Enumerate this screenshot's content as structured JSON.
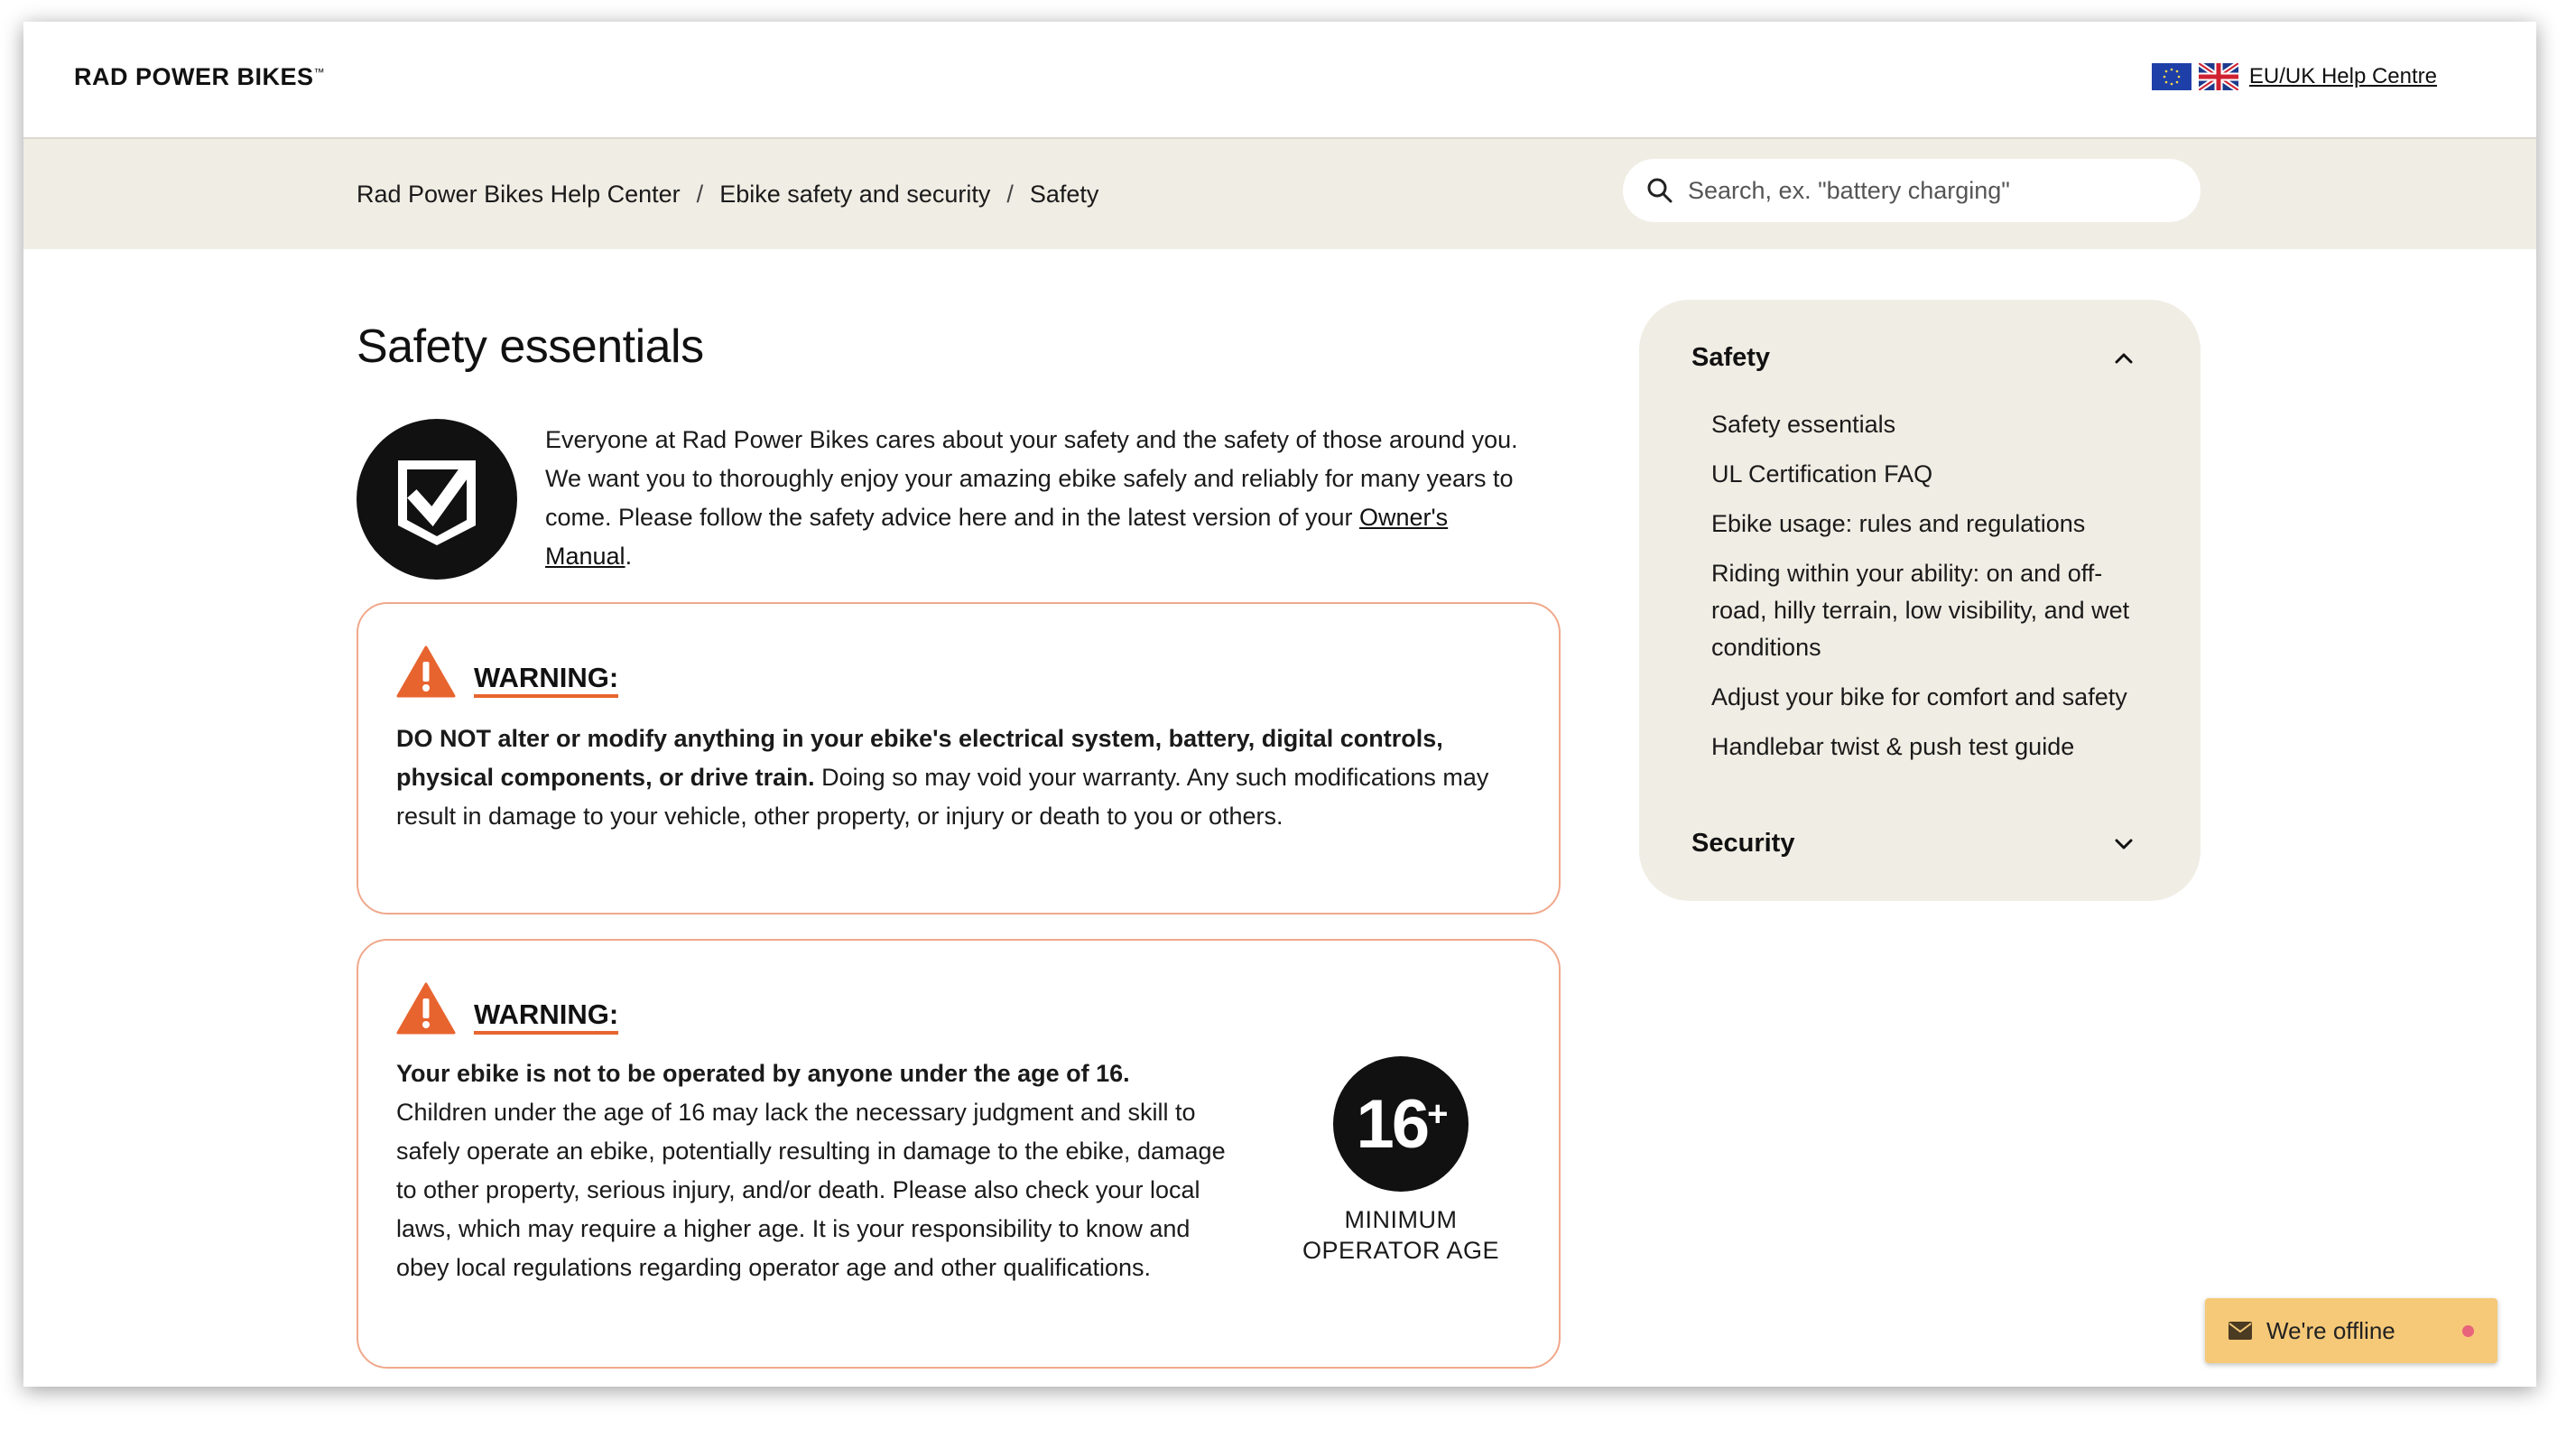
{
  "header": {
    "logo_text": "RAD POWER BIKES",
    "logo_mark": "™",
    "region_link": "EU/UK Help Centre",
    "flags": [
      "eu-flag-icon",
      "uk-flag-icon"
    ]
  },
  "breadcrumb": {
    "items": [
      "Rad Power Bikes Help Center",
      "Ebike safety and security",
      "Safety"
    ],
    "separator": "/"
  },
  "search": {
    "placeholder": "Search, ex. \"battery charging\""
  },
  "article": {
    "title": "Safety essentials",
    "intro_text": "Everyone at Rad Power Bikes cares about your safety and the safety of those around you. We want you to thoroughly enjoy your amazing ebike safely and reliably for many years to come. Please follow the safety advice here and in the latest version of your ",
    "intro_link": "Owner's Manual",
    "intro_end": ".",
    "warnings": [
      {
        "label": "WARNING:",
        "bold": "DO NOT alter or modify anything in your ebike's electrical system, battery, digital controls, physical components, or drive train.",
        "text": " Doing so may void your warranty. Any such modifications may result in damage to your vehicle, other property, or injury or death to you or others."
      },
      {
        "label": "WARNING:",
        "bold": "Your ebike is not to be operated by anyone under the age of 16.",
        "text": "Children under the age of 16 may lack the necessary judgment and skill to safely operate an ebike, potentially resulting in damage to the ebike, damage to other property, serious injury, and/or death. Please also check your local laws, which may require a higher age. It is your responsibility to know and obey local regulations regarding operator age and other qualifications.",
        "badge_number": "16",
        "badge_plus": "+",
        "badge_caption": "MINIMUM OPERATOR AGE"
      }
    ]
  },
  "sidebar": {
    "sections": [
      {
        "title": "Safety",
        "expanded": true,
        "items": [
          "Safety essentials",
          "UL Certification FAQ",
          "Ebike usage: rules and regulations",
          "Riding within your ability: on and off-road, hilly terrain, low visibility, and wet conditions",
          "Adjust your bike for comfort and safety",
          "Handlebar twist & push test guide"
        ]
      },
      {
        "title": "Security",
        "expanded": false,
        "items": []
      }
    ]
  },
  "chat_widget": {
    "label": "We're offline",
    "status_color": "#e8647a",
    "bg_color": "#f5c978"
  },
  "colors": {
    "accent": "#e8642f",
    "warning_border": "#f0a88b",
    "band_bg": "#f0ede4"
  }
}
